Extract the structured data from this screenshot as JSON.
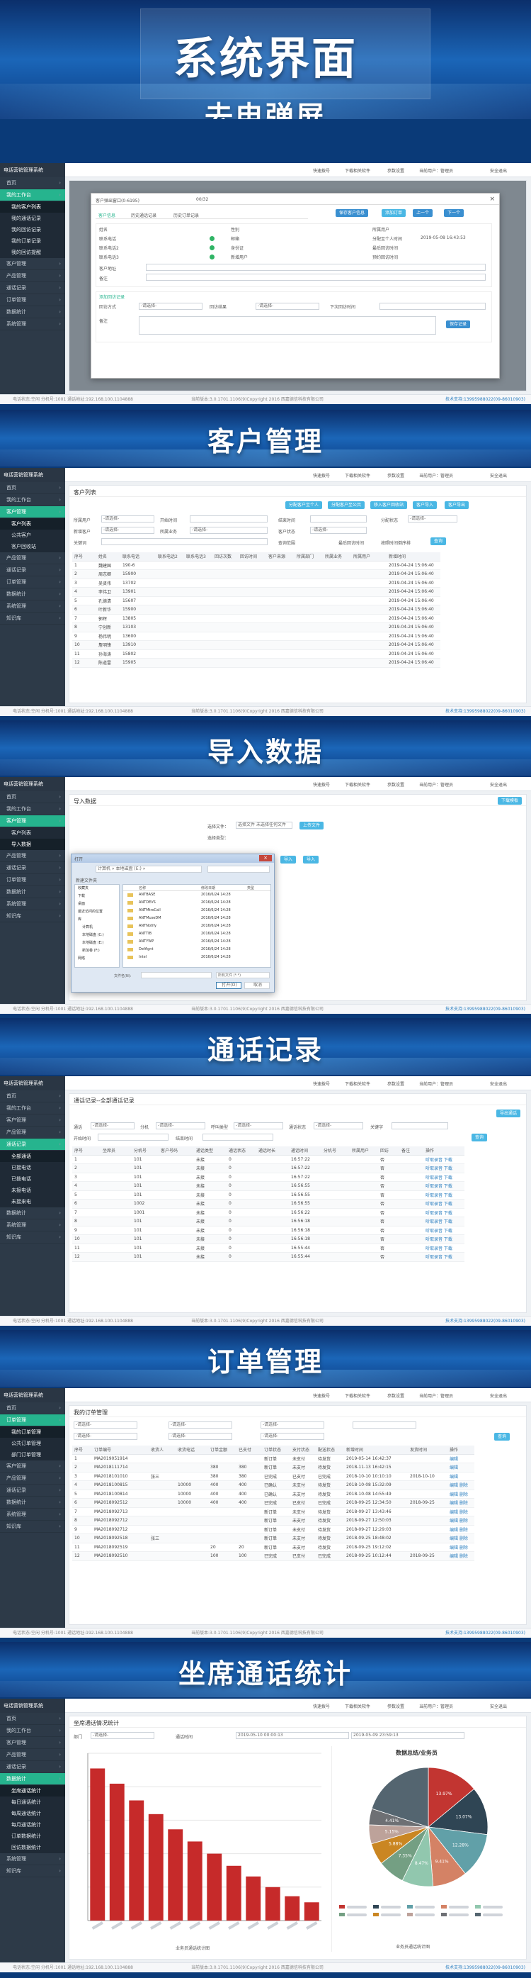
{
  "main_title": "系统界面",
  "sections": {
    "popup": "去电弹屏",
    "customer": "客户管理",
    "import": "导入数据",
    "calls": "通话记录",
    "orders": "订单管理",
    "stats": "坐席通话统计"
  },
  "app": {
    "logo": "电话营销管理系统",
    "topbar": [
      "快速拨号",
      "下载相关软件",
      "参数设置",
      "当前用户：管理员",
      "安全退出"
    ]
  },
  "menu": {
    "home": "首页",
    "my_work": "我的工作台",
    "customer_mgmt": "客户管理",
    "product_mgmt": "产品管理",
    "call_records": "通话记录",
    "order_mgmt": "订单管理",
    "stats": "数据统计",
    "system": "系统管理",
    "knowledge": "知识库"
  },
  "s1": {
    "submenu": [
      "我的客户列表",
      "我的通话记录",
      "我的回访记录",
      "我的订单记录",
      "我的回访提醒"
    ],
    "dialog_title": "客户弹出窗口(0-6195)",
    "dialog_count": "00/32",
    "dialog_tabs": [
      "客户信息",
      "历史通话记录",
      "历史订单记录"
    ],
    "dialog_btns": [
      "保存客户信息",
      "添加订单",
      "上一个",
      "下一个"
    ],
    "fields": [
      "姓名",
      "联系电话",
      "联系电话2",
      "联系电话3",
      "客户地址",
      "备注"
    ],
    "fields2": [
      "性别",
      "邮箱",
      "身份证",
      "新增用户",
      "所属用户",
      "分配至个人时间",
      "最后回访时间",
      "预约回访时间",
      "下次回访时间"
    ],
    "date_value": "2019-05-08 16:43:53",
    "visit_title": "添加回访记录",
    "visit_labels": [
      "回访方式",
      "回访结果",
      "下次回访时间",
      "备注"
    ],
    "select_placeholder": "-请选择-",
    "save_visit": "保存记录",
    "footer_left": "电话状态:空闲 分机号:1001 通话地址:192.168.100.1104888",
    "footer_mid": "当前版本:3.0.1701.1106(9)Copyright 2016 西嘉德信科技有限公司",
    "footer_right": "技术支持:13995988022(09-86010903)"
  },
  "s2": {
    "submenu": [
      "客户列表",
      "公共客户",
      "客户回收站"
    ],
    "heading": "客户列表",
    "btns": [
      "分配客户至个人",
      "分配客户至公共",
      "移入客户回收站",
      "客户导入",
      "客户导出"
    ],
    "filters": [
      "所属用户",
      "开始时间",
      "结束时间",
      "分配状态",
      "新增客户",
      "所属业务",
      "客户状态",
      "关键词",
      "查询范围",
      "最后回访时间",
      "按照时间倒序排"
    ],
    "search": "查询",
    "columns": [
      "序号",
      "姓名",
      "联系电话",
      "联系电话2",
      "联系电话3",
      "回访次数",
      "回访时间",
      "客户来源",
      "所属部门",
      "所属业务",
      "所属用户",
      "新增时间"
    ],
    "rows": [
      [
        "1",
        "魏建国",
        "190-6",
        "",
        "",
        "",
        "",
        "",
        "",
        "",
        "",
        "2019-04-24 15:06:40"
      ],
      [
        "2",
        "周志卿",
        "15900",
        "",
        "",
        "",
        "",
        "",
        "",
        "",
        "",
        "2019-04-24 15:06:40"
      ],
      [
        "3",
        "吴贤伟",
        "13702",
        "",
        "",
        "",
        "",
        "",
        "",
        "",
        "",
        "2019-04-24 15:06:40"
      ],
      [
        "4",
        "李伟卫",
        "13901",
        "",
        "",
        "",
        "",
        "",
        "",
        "",
        "",
        "2019-04-24 15:06:40"
      ],
      [
        "5",
        "孔德清",
        "15607",
        "",
        "",
        "",
        "",
        "",
        "",
        "",
        "",
        "2019-04-24 15:06:40"
      ],
      [
        "6",
        "叶新华",
        "15900",
        "",
        "",
        "",
        "",
        "",
        "",
        "",
        "",
        "2019-04-24 15:06:40"
      ],
      [
        "7",
        "郭辉",
        "13805",
        "",
        "",
        "",
        "",
        "",
        "",
        "",
        "",
        "2019-04-24 15:06:40"
      ],
      [
        "8",
        "宁创新",
        "13103",
        "",
        "",
        "",
        "",
        "",
        "",
        "",
        "",
        "2019-04-24 15:06:40"
      ],
      [
        "9",
        "杨伟明",
        "13600",
        "",
        "",
        "",
        "",
        "",
        "",
        "",
        "",
        "2019-04-24 15:06:40"
      ],
      [
        "10",
        "詹明锋",
        "13910",
        "",
        "",
        "",
        "",
        "",
        "",
        "",
        "",
        "2019-04-24 15:06:40"
      ],
      [
        "11",
        "孙海涛",
        "15802",
        "",
        "",
        "",
        "",
        "",
        "",
        "",
        "",
        "2019-04-24 15:06:40"
      ],
      [
        "12",
        "陈道雷",
        "15905",
        "",
        "",
        "",
        "",
        "",
        "",
        "",
        "",
        "2019-04-24 15:06:40"
      ]
    ],
    "tag": "预防和测试数据"
  },
  "s3": {
    "submenu": [
      "客户列表",
      "导入数据"
    ],
    "heading": "导入数据",
    "download_template": "下载模板",
    "file_label": "选择文件：",
    "file_btn": "选择文件",
    "file_none": "未选择任何文件",
    "upload": "上传文件",
    "type_label": "选择类型：",
    "dialog_title": "打开",
    "path": "计算机 » 本地磁盘 (E:) »",
    "new_folder": "新建文件夹",
    "tree": [
      "收藏夹",
      "下载",
      "桌面",
      "最近访问的位置",
      "库",
      "计算机",
      "本地磁盘 (C:)",
      "本地磁盘 (E:)",
      "新加卷 (F:)",
      "网络"
    ],
    "files": [
      [
        "ANTBASE",
        "2016/6/24 14:28"
      ],
      [
        "ANTDEVS",
        "2016/6/24 14:28"
      ],
      [
        "ANTMtrxCall",
        "2016/6/24 14:28"
      ],
      [
        "ANTMuseDM",
        "2016/6/24 14:28"
      ],
      [
        "ANTNotify",
        "2016/6/24 14:28"
      ],
      [
        "ANTTIB",
        "2016/6/24 14:28"
      ],
      [
        "ANTYWP",
        "2016/6/24 14:28"
      ],
      [
        "DefAgnt",
        "2016/6/24 14:28"
      ],
      [
        "Intel",
        "2016/6/24 14:28"
      ]
    ],
    "columns": [
      "名称",
      "修改日期",
      "类型"
    ],
    "filename_label": "文件名(N):",
    "filetype": "所有文件 (*.*)",
    "open": "打开(O)",
    "cancel": "取消",
    "btn_a": "导入",
    "btn_b": "导入"
  },
  "s4": {
    "submenu": [
      "全部通话",
      "已接电话",
      "已拨电话",
      "未接电话",
      "未接来电"
    ],
    "heading": "通话记录--全部通话记录",
    "export": "导出通话",
    "filters": [
      "通话",
      "分机",
      "呼叫类型",
      "通话状态",
      "关键字",
      "开始时间",
      "结束时间",
      "查询"
    ],
    "columns": [
      "序号",
      "坐席员",
      "分机号",
      "客户号码",
      "通话类型",
      "通话状态",
      "通话时长",
      "通话时间",
      "分机号",
      "所属用户",
      "回访",
      "备注",
      "操作"
    ],
    "rows": [
      [
        "1",
        "",
        "101",
        "",
        "未接",
        "0",
        "16:57:22",
        "否",
        "听取录音 下载"
      ],
      [
        "2",
        "",
        "101",
        "",
        "未接",
        "0",
        "16:57:22",
        "否",
        "听取录音 下载"
      ],
      [
        "3",
        "",
        "101",
        "",
        "未接",
        "0",
        "16:57:22",
        "否",
        "听取录音 下载"
      ],
      [
        "4",
        "",
        "101",
        "",
        "未接",
        "0",
        "16:56:55",
        "否",
        "听取录音 下载"
      ],
      [
        "5",
        "",
        "101",
        "",
        "未接",
        "0",
        "16:56:55",
        "否",
        "听取录音 下载"
      ],
      [
        "6",
        "",
        "1002",
        "",
        "未接",
        "0",
        "16:56:55",
        "否",
        "听取录音 下载"
      ],
      [
        "7",
        "",
        "1001",
        "",
        "未接",
        "0",
        "16:56:22",
        "否",
        "听取录音 下载"
      ],
      [
        "8",
        "",
        "101",
        "",
        "未接",
        "0",
        "16:56:18",
        "否",
        "听取录音 下载"
      ],
      [
        "9",
        "",
        "101",
        "",
        "未接",
        "0",
        "16:56:18",
        "否",
        "听取录音 下载"
      ],
      [
        "10",
        "",
        "101",
        "",
        "未接",
        "0",
        "16:56:18",
        "否",
        "听取录音 下载"
      ],
      [
        "11",
        "",
        "101",
        "",
        "未接",
        "0",
        "16:55:44",
        "否",
        "听取录音 下载"
      ],
      [
        "12",
        "",
        "101",
        "",
        "未接",
        "0",
        "16:55:44",
        "否",
        "听取录音 下载"
      ]
    ]
  },
  "s5": {
    "submenu": [
      "我的订单管理",
      "公共订单管理",
      "部门订单管理"
    ],
    "heading": "我的订单管理",
    "columns": [
      "序号",
      "订单编号",
      "收货人",
      "收货电话",
      "订单金额",
      "已支付",
      "订单状态",
      "支付状态",
      "配送状态",
      "新增时间",
      "发货时间",
      "操作"
    ],
    "rows": [
      [
        "1",
        "MA2019051914",
        "",
        "",
        "",
        "",
        "新订单",
        "未支付",
        "待发货",
        "2019-05-14 16:42:37",
        "",
        "编辑"
      ],
      [
        "2",
        "MA2018111714",
        "",
        "",
        "380",
        "380",
        "新订单",
        "未支付",
        "待发货",
        "2018-11-13 16:42:15",
        "",
        "编辑"
      ],
      [
        "3",
        "MA2018101010",
        "张三",
        "",
        "380",
        "380",
        "已完成",
        "已支付",
        "已完成",
        "2018-10-10 10:10:10",
        "2018-10-10",
        "编辑"
      ],
      [
        "4",
        "MA2018100815",
        "",
        "10000",
        "400",
        "400",
        "已确认",
        "未支付",
        "待发货",
        "2018-10-08 15:32:09",
        "",
        "编辑 删除"
      ],
      [
        "5",
        "MA2018100814",
        "",
        "10000",
        "400",
        "400",
        "已确认",
        "未支付",
        "待发货",
        "2018-10-08 14:55:49",
        "",
        "编辑 删除"
      ],
      [
        "6",
        "MA2018092512",
        "",
        "10000",
        "400",
        "400",
        "已完成",
        "已支付",
        "已完成",
        "2018-09-25 12:34:50",
        "2018-09-25",
        "编辑 删除"
      ],
      [
        "7",
        "MA2018092713",
        "",
        "",
        "",
        "",
        "新订单",
        "未支付",
        "待发货",
        "2018-09-27 13:43:46",
        "",
        "编辑 删除"
      ],
      [
        "8",
        "MA2018092712",
        "",
        "",
        "",
        "",
        "新订单",
        "未支付",
        "待发货",
        "2018-09-27 12:50:03",
        "",
        "编辑 删除"
      ],
      [
        "9",
        "MA2018092712",
        "",
        "",
        "",
        "",
        "新订单",
        "未支付",
        "待发货",
        "2018-09-27 12:29:03",
        "",
        "编辑 删除"
      ],
      [
        "10",
        "MA2018092518",
        "张三",
        "",
        "",
        "",
        "新订单",
        "未支付",
        "待发货",
        "2018-09-25 18:48:02",
        "",
        "编辑 删除"
      ],
      [
        "11",
        "MA2018092519",
        "",
        "",
        "20",
        "20",
        "新订单",
        "未支付",
        "待发货",
        "2018-09-25 19:12:02",
        "",
        "编辑 删除"
      ],
      [
        "12",
        "MA2018092510",
        "",
        "",
        "100",
        "100",
        "已完成",
        "已支付",
        "已完成",
        "2018-09-25 10:12:44",
        "2018-09-25",
        "编辑 删除"
      ]
    ]
  },
  "s6": {
    "submenu": [
      "坐席通话统计",
      "每日通话统计",
      "每周通话统计",
      "每月通话统计",
      "订单数据统计",
      "回访数据统计"
    ],
    "heading": "坐席通话情况统计",
    "filter_labels": [
      "部门",
      "通话时间"
    ],
    "date_from": "2019-05-10 00:00:13",
    "date_to": "2019-05-09 23:59:13",
    "pie_title": "数据总结/业务员",
    "bar_caption": "业务员通话统计图",
    "pie_caption": "业务员通话统计图",
    "pie_labels": [
      "13.97%",
      "13.07%",
      "12.28%",
      "9.41%",
      "8.47%",
      "7.35%",
      "5.88%",
      "5.15%",
      "4.41%"
    ]
  },
  "chart_data": [
    {
      "type": "bar",
      "title": "",
      "categories": [
        "",
        "",
        "",
        "",
        "",
        "",
        "",
        "",
        "",
        "",
        "",
        ""
      ],
      "series": [
        {
          "values": [
            100,
            90,
            79,
            70,
            60,
            52,
            44,
            36,
            29,
            22,
            16,
            12
          ]
        }
      ],
      "ylim": [
        0,
        110
      ],
      "grid": true
    },
    {
      "type": "pie",
      "title": "数据总结/业务员",
      "values": [
        13.97,
        13.07,
        12.28,
        9.41,
        8.47,
        7.35,
        5.88,
        5.15,
        4.41,
        20.01
      ],
      "colors": [
        "#c23531",
        "#2f4554",
        "#61a0a8",
        "#d48265",
        "#91c7ae",
        "#749f83",
        "#ca8622",
        "#bda29a",
        "#6e7074",
        "#546570"
      ]
    }
  ],
  "colors": {
    "accent": "#26b48e",
    "button": "#4ab7e4",
    "sidebar": "#2d3a48",
    "bar": "#c62a2a"
  }
}
